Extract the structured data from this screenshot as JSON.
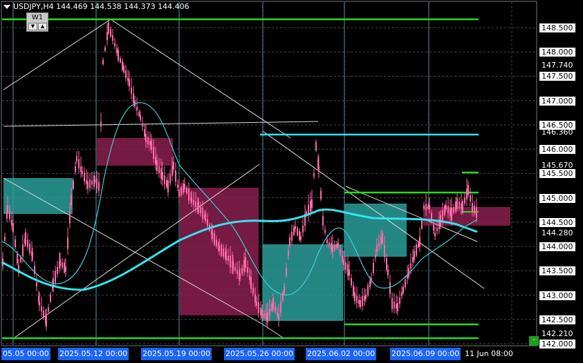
{
  "header": {
    "symbol": "USDJPY,H4",
    "open": "144.469",
    "high": "144.538",
    "low": "144.373",
    "close": "144.406"
  },
  "zone_label": "W1",
  "price_scale": [
    {
      "text": "148.500",
      "box": true
    },
    {
      "text": "148.000",
      "box": true
    },
    {
      "text": "147.740",
      "box": false
    },
    {
      "text": "147.500",
      "box": true
    },
    {
      "text": "147.000",
      "box": true
    },
    {
      "text": "146.500",
      "box": true
    },
    {
      "text": "146.360",
      "box": false
    },
    {
      "text": "146.000",
      "box": true
    },
    {
      "text": "145.670",
      "box": false
    },
    {
      "text": "145.500",
      "box": true
    },
    {
      "text": "145.000",
      "box": true
    },
    {
      "text": "144.500",
      "box": true
    },
    {
      "text": "144.280",
      "box": false
    },
    {
      "text": "144.000",
      "box": true
    },
    {
      "text": "143.500",
      "box": true
    },
    {
      "text": "143.000",
      "box": true
    },
    {
      "text": "142.500",
      "box": true
    },
    {
      "text": "142.210",
      "box": false
    },
    {
      "text": "142.000",
      "box": true
    }
  ],
  "time_scale": [
    {
      "text": "05.05 00:00",
      "box": true
    },
    {
      "text": "2025.05.12 00:00",
      "box": true
    },
    {
      "text": "2025.05.19 00:00",
      "box": true
    },
    {
      "text": "2025.05.26 00:00",
      "box": true
    },
    {
      "text": "2025.06.02 00:00",
      "box": true
    },
    {
      "text": "2025.06.09 00:00",
      "box": true
    },
    {
      "text": "11 Jun 08:00",
      "box": false
    }
  ],
  "colors": {
    "background": "#000000",
    "grid": "#4a4a4a",
    "candle": "#ff6aa8",
    "ma_slow": "#33e6f0",
    "ma_fast": "#3fcfd6",
    "level_green": "#20e020",
    "level_cyan": "#33e6f0",
    "zone_demand": "#2a9d9a",
    "zone_supply": "#8a1f4e",
    "vertical": "#59c8d6"
  }
}
